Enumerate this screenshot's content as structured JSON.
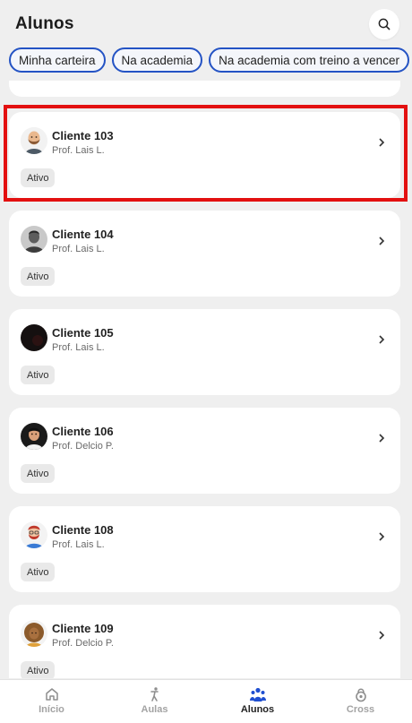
{
  "header": {
    "title": "Alunos",
    "search_icon": "search-icon"
  },
  "filters": [
    "Minha carteira",
    "Na academia",
    "Na academia com treino a vencer"
  ],
  "students": [
    {
      "name": "Cliente 103",
      "professor": "Prof. Lais L.",
      "status": "Ativo",
      "avatar": "bald-beard-avatar"
    },
    {
      "name": "Cliente 104",
      "professor": "Prof. Lais L.",
      "status": "Ativo",
      "avatar": "default-person-avatar"
    },
    {
      "name": "Cliente 105",
      "professor": "Prof. Lais L.",
      "status": "Ativo",
      "avatar": "dark-photo-avatar"
    },
    {
      "name": "Cliente 106",
      "professor": "Prof. Delcio P.",
      "status": "Ativo",
      "avatar": "dark-hair-man-avatar"
    },
    {
      "name": "Cliente 108",
      "professor": "Prof. Lais L.",
      "status": "Ativo",
      "avatar": "red-beard-glasses-avatar"
    },
    {
      "name": "Cliente 109",
      "professor": "Prof. Delcio P.",
      "status": "Ativo",
      "avatar": "curly-hair-woman-avatar"
    }
  ],
  "nav": [
    {
      "label": "Início",
      "icon": "home-icon",
      "active": false
    },
    {
      "label": "Aulas",
      "icon": "exercise-person-icon",
      "active": false
    },
    {
      "label": "Alunos",
      "icon": "group-people-icon",
      "active": true
    },
    {
      "label": "Cross",
      "icon": "kettlebell-icon",
      "active": false
    }
  ],
  "colors": {
    "accent": "#2453c4",
    "highlight": "#e31010",
    "active_nav": "#1f4fd1"
  }
}
